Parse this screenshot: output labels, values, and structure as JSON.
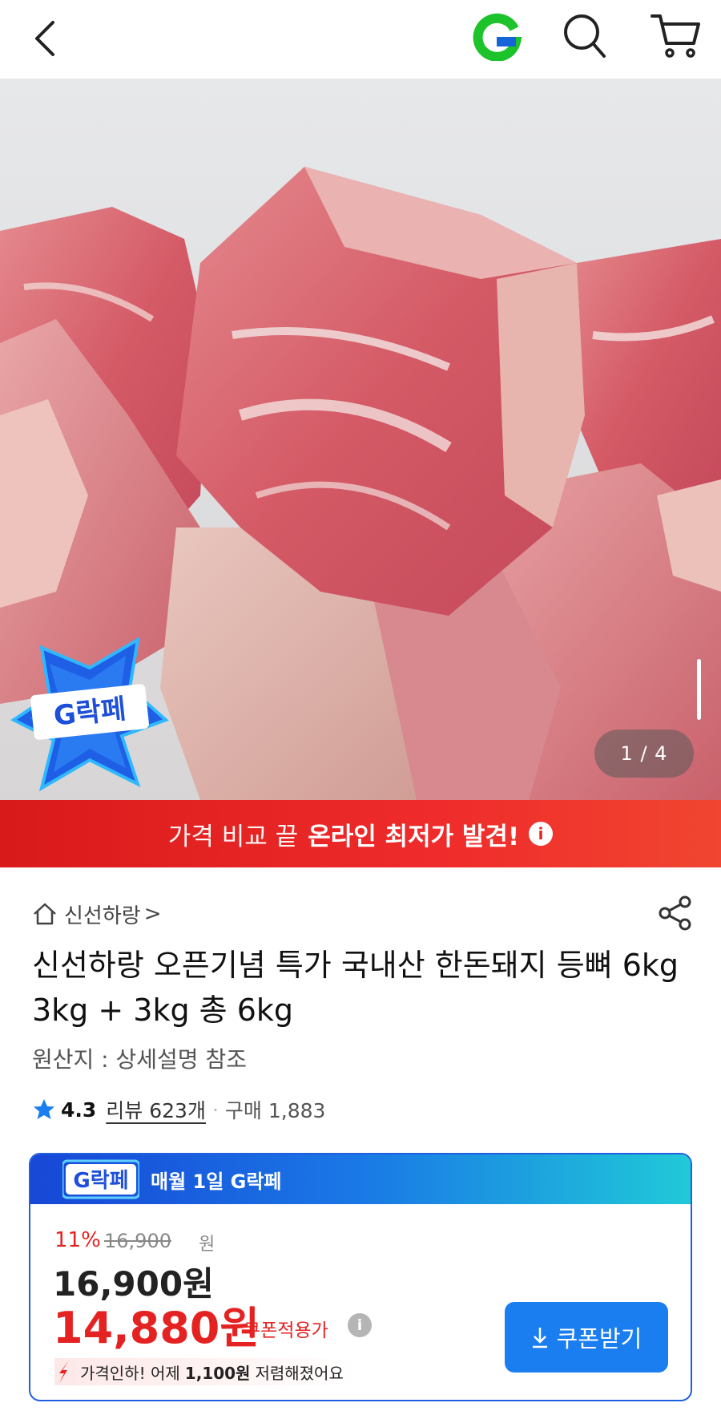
{
  "header": {
    "back_icon": "chevron-left-icon",
    "logo_letter": "G",
    "logo_color": "#1dc32a",
    "search_icon": "search-icon",
    "cart_icon": "cart-icon"
  },
  "hero": {
    "image_description_icon": "product-photo",
    "badge_text": "G락페",
    "pager": "1 / 4"
  },
  "banner": {
    "light_text": "가격 비교 끝",
    "bold_text": "온라인 최저가 발견!",
    "info_icon": "i",
    "color": "#e52222"
  },
  "product": {
    "store_name": "신선하랑",
    "store_chevron": ">",
    "title": "신선하랑 오픈기념 특가 국내산 한돈돼지 등뼈 6kg 3kg + 3kg 총 6kg",
    "origin": "원산지 : 상세설명 참조",
    "rating": "4.3",
    "review_label": "리뷰 623개",
    "dot": "·",
    "purchases": "구매 1,883"
  },
  "promo_card": {
    "badge_text": "G락페",
    "header_text": "매월 1일 G락페",
    "discount_pct": "11%",
    "original_price": "16,900",
    "original_won": "원",
    "price": "16,900원",
    "sale_price": "14,880원",
    "sale_label": "쿠폰적용가",
    "sale_info_icon": "i",
    "drop_prefix": "가격인하! 어제",
    "drop_amount": "1,100원",
    "drop_suffix": "저렴해졌어요",
    "coupon_button": "쿠폰받기",
    "accent": "#1a7ef0"
  }
}
